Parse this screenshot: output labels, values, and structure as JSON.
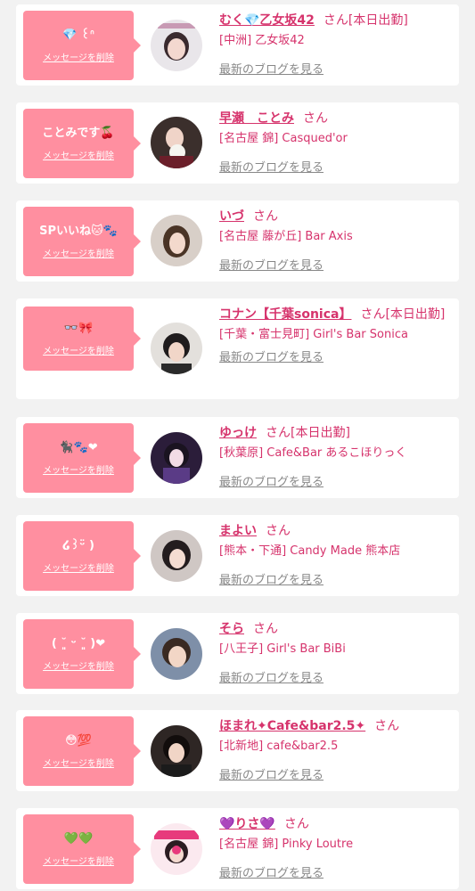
{
  "delete_label": "メッセージを削除",
  "blog_label": "最新のブログを見る",
  "san_label": "さん",
  "colors": {
    "bubble": "#ff8fa0",
    "accent": "#d6336c",
    "background": "#f2f2f2"
  },
  "cards": [
    {
      "message": "💎 ꒰ᐢ",
      "name": "むく💎乙女坂42",
      "honorific": "さん[本日出勤]",
      "shop": "[中洲] 乙女坂42"
    },
    {
      "message": "ことみです🍒",
      "name": "早瀬　ことみ",
      "honorific": "さん",
      "shop": "[名古屋 錦] Casqued'or"
    },
    {
      "message": "SPいいね🐱🐾",
      "name": "いづ",
      "honorific": "さん",
      "shop": "[名古屋 藤が丘] Bar Axis"
    },
    {
      "message": "👓🎀",
      "name": "コナン【千葉sonica】",
      "honorific": "さん[本日出勤]",
      "shop": "[千葉・富士見町] Girl's Bar Sonica"
    },
    {
      "message": "🐈‍⬛🐾❤",
      "name": "ゆっけ",
      "honorific": "さん[本日出勤]",
      "shop": "[秋葉原] Cafe&Bar あるこほりっく"
    },
    {
      "message": "໒꒱ᵕ̈ )",
      "name": "まよい",
      "honorific": "さん",
      "shop": "[熊本・下通] Candy Made 熊本店"
    },
    {
      "message": "( ˘͈ ᵕ ˘͈ )❤",
      "name": "そら",
      "honorific": "さん",
      "shop": "[八王子] Girl's Bar BiBi"
    },
    {
      "message": "😳💯",
      "name": "ほまれ✦Cafe&bar2.5✦",
      "honorific": "さん",
      "shop": "[北新地] cafe&bar2.5"
    },
    {
      "message": "💚💚",
      "name": "💜りさ💜",
      "honorific": "さん",
      "shop": "[名古屋 錦] Pinky Loutre"
    }
  ]
}
